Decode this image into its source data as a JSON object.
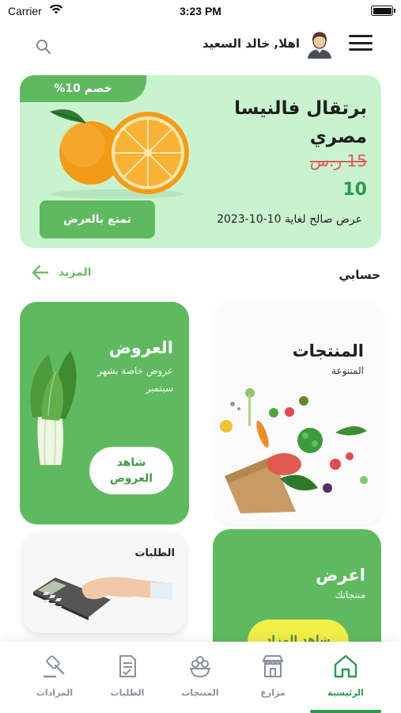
{
  "status_bar": {
    "carrier": "Carrier",
    "time": "3:23 PM"
  },
  "header": {
    "greeting": "اهلا, خالد السعيد",
    "icons": [
      "search-icon",
      "user-avatar",
      "hamburger-menu-icon"
    ]
  },
  "offer_banner": {
    "discount": "خصم 10%",
    "product_name": "برتقال فالنيسا مصري",
    "old_price": "15 ر.س",
    "new_price": "10",
    "validity": "عرض صالح لغاية 10-10-2023",
    "button_label": "تمتع بالعرض",
    "colors": {
      "background": "#c9f3cf",
      "accent": "#5fba5f",
      "old_price": "#e05a5a",
      "new_price": "#2c9a4e"
    }
  },
  "section": {
    "title": "حسابي",
    "more_label": "المزيد"
  },
  "cards": {
    "offers": {
      "title": "العروض",
      "subtitle": "عروض خاصة بشهر سبتمبر",
      "button_label": "شاهد العروض"
    },
    "products": {
      "title": "المنتجات",
      "subtitle": "المتنوعة"
    },
    "orders": {
      "title": "الطلبات"
    },
    "showcase": {
      "title": "اعرض",
      "subtitle": "منتجاتك",
      "button_label": "شاهد المزاد"
    }
  },
  "bottom_nav": {
    "items": [
      {
        "label": "الرئيسية",
        "icon": "home-icon",
        "active": true
      },
      {
        "label": "مزارع",
        "icon": "farm-store-icon",
        "active": false
      },
      {
        "label": "المنتجات",
        "icon": "products-icon",
        "active": false
      },
      {
        "label": "الطلبات",
        "icon": "orders-icon",
        "active": false
      },
      {
        "label": "المزادات",
        "icon": "auction-gavel-icon",
        "active": false
      }
    ],
    "colors": {
      "active": "#2c9a4e",
      "inactive": "#8a8fa0"
    }
  }
}
